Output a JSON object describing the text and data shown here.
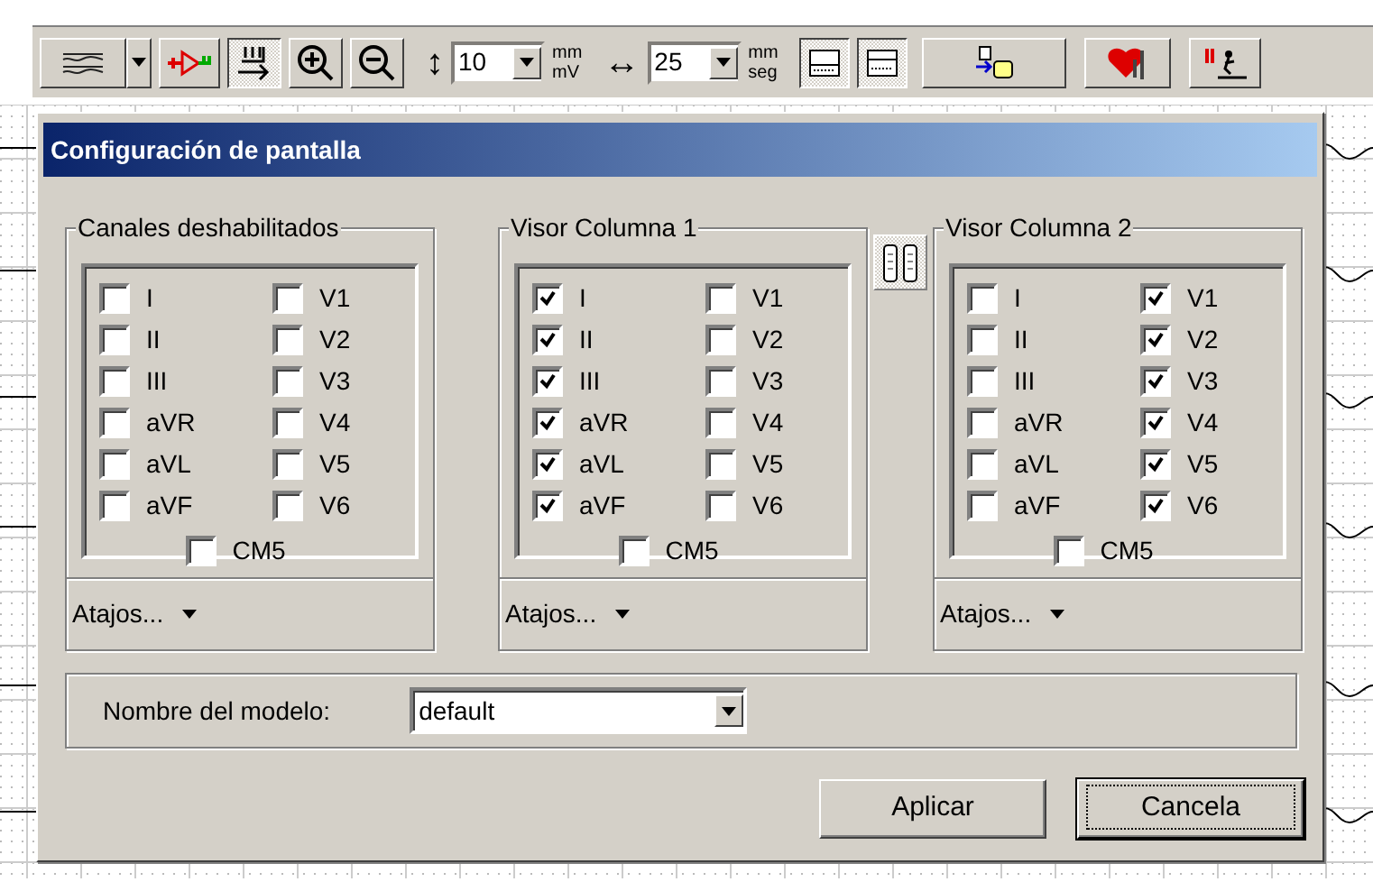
{
  "toolbar": {
    "buttons": [
      {
        "pressed": false
      },
      {
        "pressed": false
      },
      {
        "pressed": true
      },
      {
        "pressed": false
      },
      {
        "pressed": false
      }
    ],
    "vertical_arrow": "↕",
    "amplitude": {
      "value": "10",
      "unit_top": "mm",
      "unit_bottom": "mV"
    },
    "horizontal_arrow": "↔",
    "speed": {
      "value": "25",
      "unit_top": "mm",
      "unit_bottom": "seg"
    },
    "right_buttons": [
      {
        "pressed": true
      },
      {
        "pressed": true
      },
      {
        "pressed": false
      },
      {
        "pressed": false
      },
      {
        "pressed": false
      }
    ]
  },
  "dialog": {
    "title": "Configuración de pantalla",
    "groups": [
      {
        "title": "Canales deshabilitados",
        "left": [
          {
            "label": "I",
            "checked": false
          },
          {
            "label": "II",
            "checked": false
          },
          {
            "label": "III",
            "checked": false
          },
          {
            "label": "aVR",
            "checked": false
          },
          {
            "label": "aVL",
            "checked": false
          },
          {
            "label": "aVF",
            "checked": false
          }
        ],
        "right": [
          {
            "label": "V1",
            "checked": false
          },
          {
            "label": "V2",
            "checked": false
          },
          {
            "label": "V3",
            "checked": false
          },
          {
            "label": "V4",
            "checked": false
          },
          {
            "label": "V5",
            "checked": false
          },
          {
            "label": "V6",
            "checked": false
          }
        ],
        "extra": {
          "label": "CM5",
          "checked": false
        },
        "shortcuts": "Atajos..."
      },
      {
        "title": "Visor Columna 1",
        "left": [
          {
            "label": "I",
            "checked": true
          },
          {
            "label": "II",
            "checked": true
          },
          {
            "label": "III",
            "checked": true
          },
          {
            "label": "aVR",
            "checked": true
          },
          {
            "label": "aVL",
            "checked": true
          },
          {
            "label": "aVF",
            "checked": true
          }
        ],
        "right": [
          {
            "label": "V1",
            "checked": false
          },
          {
            "label": "V2",
            "checked": false
          },
          {
            "label": "V3",
            "checked": false
          },
          {
            "label": "V4",
            "checked": false
          },
          {
            "label": "V5",
            "checked": false
          },
          {
            "label": "V6",
            "checked": false
          }
        ],
        "extra": {
          "label": "CM5",
          "checked": false
        },
        "shortcuts": "Atajos..."
      },
      {
        "title": "Visor Columna 2",
        "left": [
          {
            "label": "I",
            "checked": false
          },
          {
            "label": "II",
            "checked": false
          },
          {
            "label": "III",
            "checked": false
          },
          {
            "label": "aVR",
            "checked": false
          },
          {
            "label": "aVL",
            "checked": false
          },
          {
            "label": "aVF",
            "checked": false
          }
        ],
        "right": [
          {
            "label": "V1",
            "checked": true
          },
          {
            "label": "V2",
            "checked": true
          },
          {
            "label": "V3",
            "checked": true
          },
          {
            "label": "V4",
            "checked": true
          },
          {
            "label": "V5",
            "checked": true
          },
          {
            "label": "V6",
            "checked": true
          }
        ],
        "extra": {
          "label": "CM5",
          "checked": false
        },
        "shortcuts": "Atajos..."
      }
    ],
    "model": {
      "label": "Nombre del modelo:",
      "value": "default"
    },
    "buttons": [
      {
        "label": "Aplicar",
        "focused": false
      },
      {
        "label": "Cancela",
        "focused": true
      }
    ]
  }
}
